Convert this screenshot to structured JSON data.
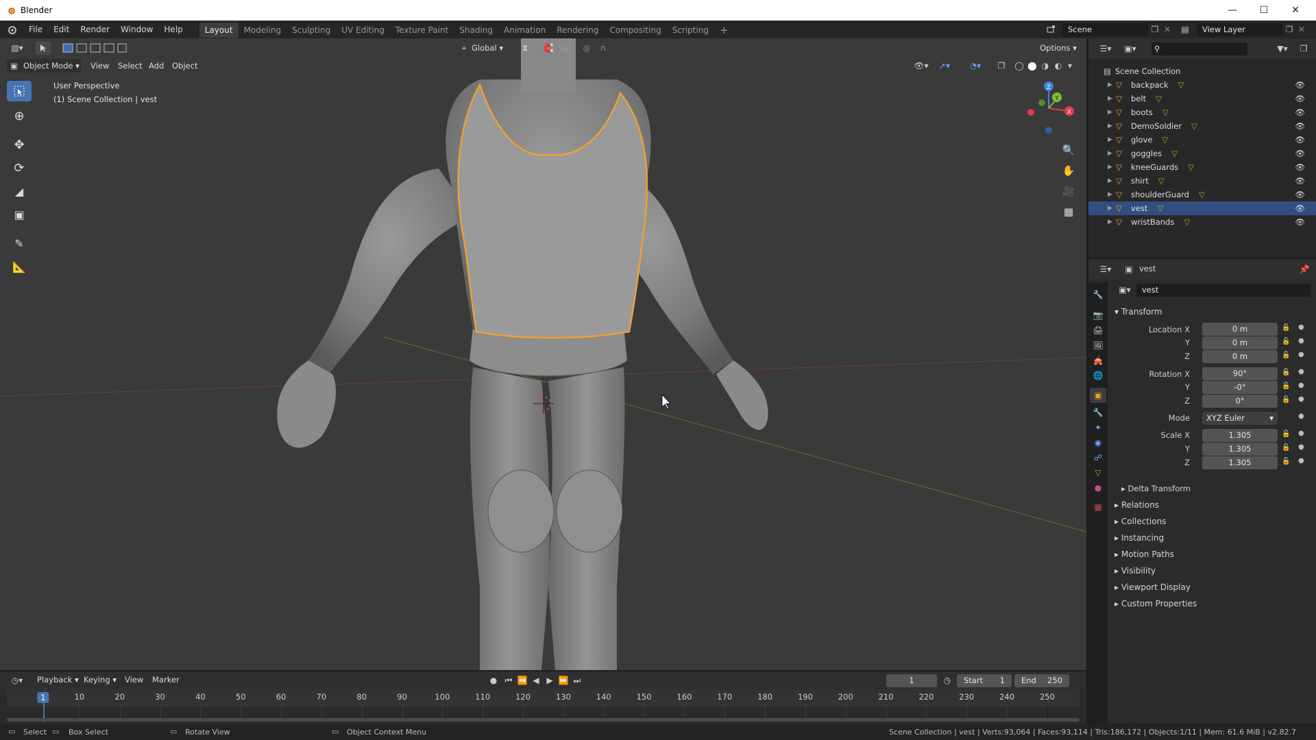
{
  "window": {
    "title": "Blender"
  },
  "menu": [
    "File",
    "Edit",
    "Render",
    "Window",
    "Help"
  ],
  "workspaces": [
    "Layout",
    "Modeling",
    "Sculpting",
    "UV Editing",
    "Texture Paint",
    "Shading",
    "Animation",
    "Rendering",
    "Compositing",
    "Scripting"
  ],
  "scene": {
    "label": "Scene",
    "view_layer": "View Layer"
  },
  "toolbar": {
    "orientation": "Global",
    "options": "Options"
  },
  "viewport": {
    "mode": "Object Mode",
    "menus": [
      "View",
      "Select",
      "Add",
      "Object"
    ],
    "info_line1": "User Perspective",
    "info_line2": "(1) Scene Collection | vest",
    "gizmo": {
      "z": "Z",
      "y": "Y",
      "x": "X"
    }
  },
  "outliner": {
    "collection": "Scene Collection",
    "items": [
      {
        "name": "backpack",
        "selected": false
      },
      {
        "name": "belt",
        "selected": false
      },
      {
        "name": "boots",
        "selected": false
      },
      {
        "name": "DemoSoldier",
        "selected": false
      },
      {
        "name": "glove",
        "selected": false
      },
      {
        "name": "goggles",
        "selected": false
      },
      {
        "name": "kneeGuards",
        "selected": false
      },
      {
        "name": "shirt",
        "selected": false
      },
      {
        "name": "shoulderGuard",
        "selected": false
      },
      {
        "name": "vest",
        "selected": true
      },
      {
        "name": "wristBands",
        "selected": false
      }
    ]
  },
  "properties": {
    "object_name": "vest",
    "datablock_name": "vest",
    "transform_title": "Transform",
    "location": {
      "label_x": "Location X",
      "label_y": "Y",
      "label_z": "Z",
      "x": "0 m",
      "y": "0 m",
      "z": "0 m"
    },
    "rotation": {
      "label_x": "Rotation X",
      "label_y": "Y",
      "label_z": "Z",
      "x": "90°",
      "y": "-0°",
      "z": "0°"
    },
    "mode": {
      "label": "Mode",
      "value": "XYZ Euler"
    },
    "scale": {
      "label_x": "Scale X",
      "label_y": "Y",
      "label_z": "Z",
      "x": "1.305",
      "y": "1.305",
      "z": "1.305"
    },
    "delta": "Delta Transform",
    "panels": [
      "Relations",
      "Collections",
      "Instancing",
      "Motion Paths",
      "Visibility",
      "Viewport Display",
      "Custom Properties"
    ]
  },
  "timeline": {
    "menus": [
      "Playback",
      "Keying",
      "View",
      "Marker"
    ],
    "current_frame": "1",
    "start_label": "Start",
    "start": "1",
    "end_label": "End",
    "end": "250",
    "ticks": [
      "1",
      "10",
      "20",
      "30",
      "40",
      "50",
      "60",
      "70",
      "80",
      "90",
      "100",
      "110",
      "120",
      "130",
      "140",
      "150",
      "160",
      "170",
      "180",
      "190",
      "200",
      "210",
      "220",
      "230",
      "240",
      "250"
    ]
  },
  "status": {
    "select": "Select",
    "box_select": "Box Select",
    "rotate": "Rotate View",
    "context": "Object Context Menu",
    "stats": "Scene Collection | vest | Verts:93,064 | Faces:93,114 | Tris:186,172 | Objects:1/11 | Mem: 61.6 MiB | v2.82.7"
  },
  "colors": {
    "accent": "#334d80",
    "selection_outline": "#f0a030",
    "x_axis": "#e03a4f",
    "y_axis": "#7fbf2a",
    "z_axis": "#3c84dd"
  }
}
